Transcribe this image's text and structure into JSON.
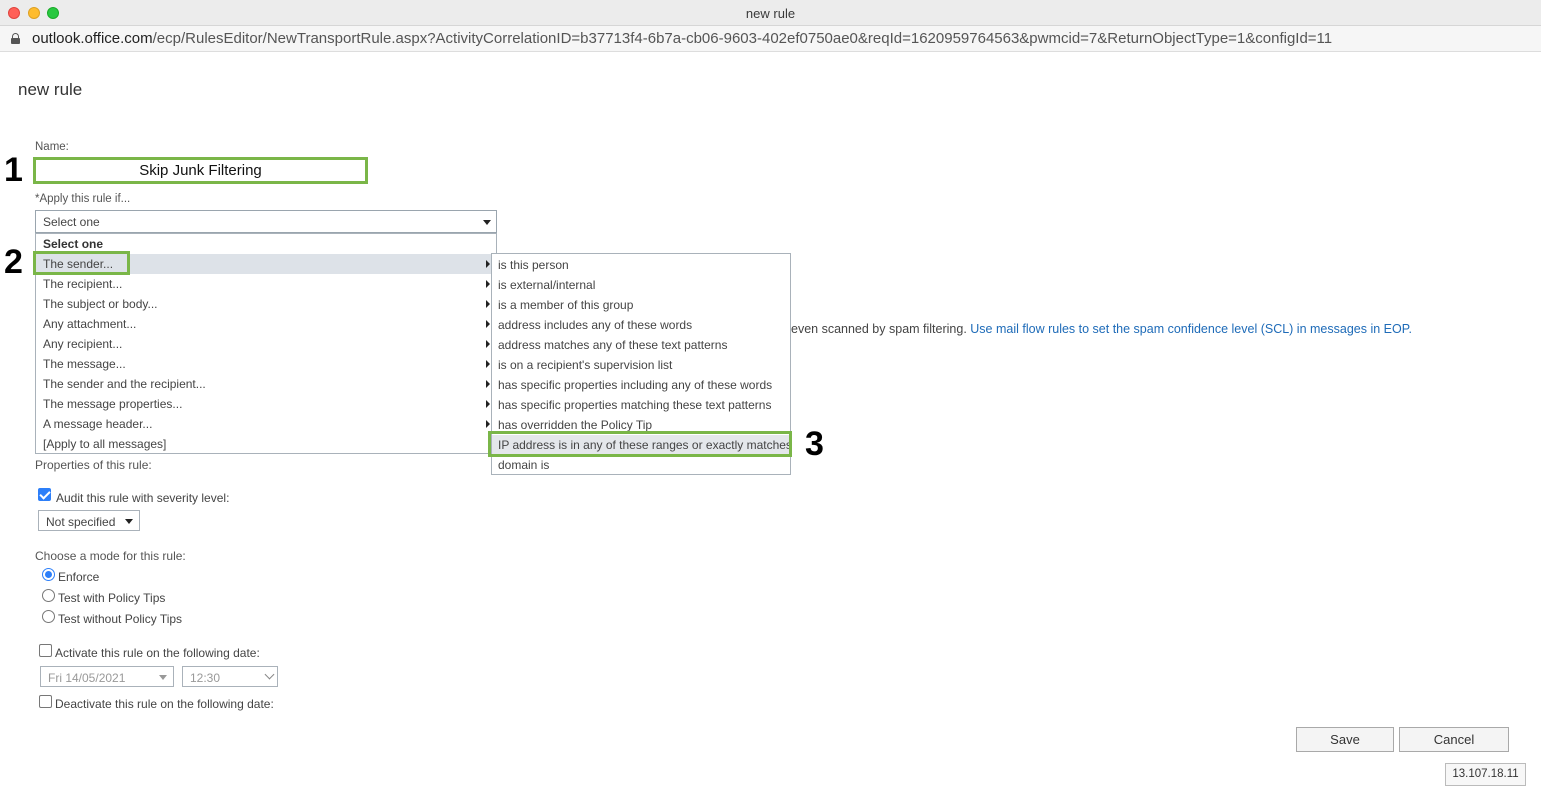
{
  "window": {
    "title": "new rule",
    "url_domain": "outlook.office.com",
    "url_path": "/ecp/RulesEditor/NewTransportRule.aspx?ActivityCorrelationID=b37713f4-6b7a-cb06-9603-402ef0750ae0&reqId=1620959764563&pwmcid=7&ReturnObjectType=1&configId=11"
  },
  "page": {
    "title": "new rule"
  },
  "annotations": {
    "step1": "1",
    "step2": "2",
    "step3": "3",
    "highlight_color": "#7ab648"
  },
  "form": {
    "name_label": "Name:",
    "name_value": "Skip Junk Filtering",
    "apply_label": "*Apply this rule if...",
    "apply_select_value": "Select one",
    "dropdown_items": [
      "Select one",
      "The sender...",
      "The recipient...",
      "The subject or body...",
      "Any attachment...",
      "Any recipient...",
      "The message...",
      "The sender and the recipient...",
      "The message properties...",
      "A message header...",
      "[Apply to all messages]"
    ],
    "submenu_items": [
      "is this person",
      "is external/internal",
      "is a member of this group",
      "address includes any of these words",
      "address matches any of these text patterns",
      "is on a recipient's supervision list",
      "has specific properties including any of these words",
      "has specific properties matching these text patterns",
      "has overridden the Policy Tip",
      "IP address is in any of these ranges or exactly matches",
      "domain is"
    ],
    "info_text": "even scanned by spam filtering.",
    "info_link": "Use mail flow rules to set the spam confidence level (SCL) in messages in EOP.",
    "properties_label": "Properties of this rule:",
    "audit_label": "Audit this rule with severity level:",
    "audit_checked": true,
    "severity_value": "Not specified",
    "mode_label": "Choose a mode for this rule:",
    "modes": [
      "Enforce",
      "Test with Policy Tips",
      "Test without Policy Tips"
    ],
    "selected_mode": "Enforce",
    "activate_label": "Activate this rule on the following date:",
    "activate_date": "Fri 14/05/2021",
    "activate_time": "12:30",
    "deactivate_label": "Deactivate this rule on the following date:"
  },
  "buttons": {
    "save": "Save",
    "cancel": "Cancel"
  },
  "status": {
    "ip": "13.107.18.11"
  },
  "colors": {
    "link": "#1e6bb8",
    "accent": "#2d7ff9",
    "hover_row": "#dde2e8"
  }
}
